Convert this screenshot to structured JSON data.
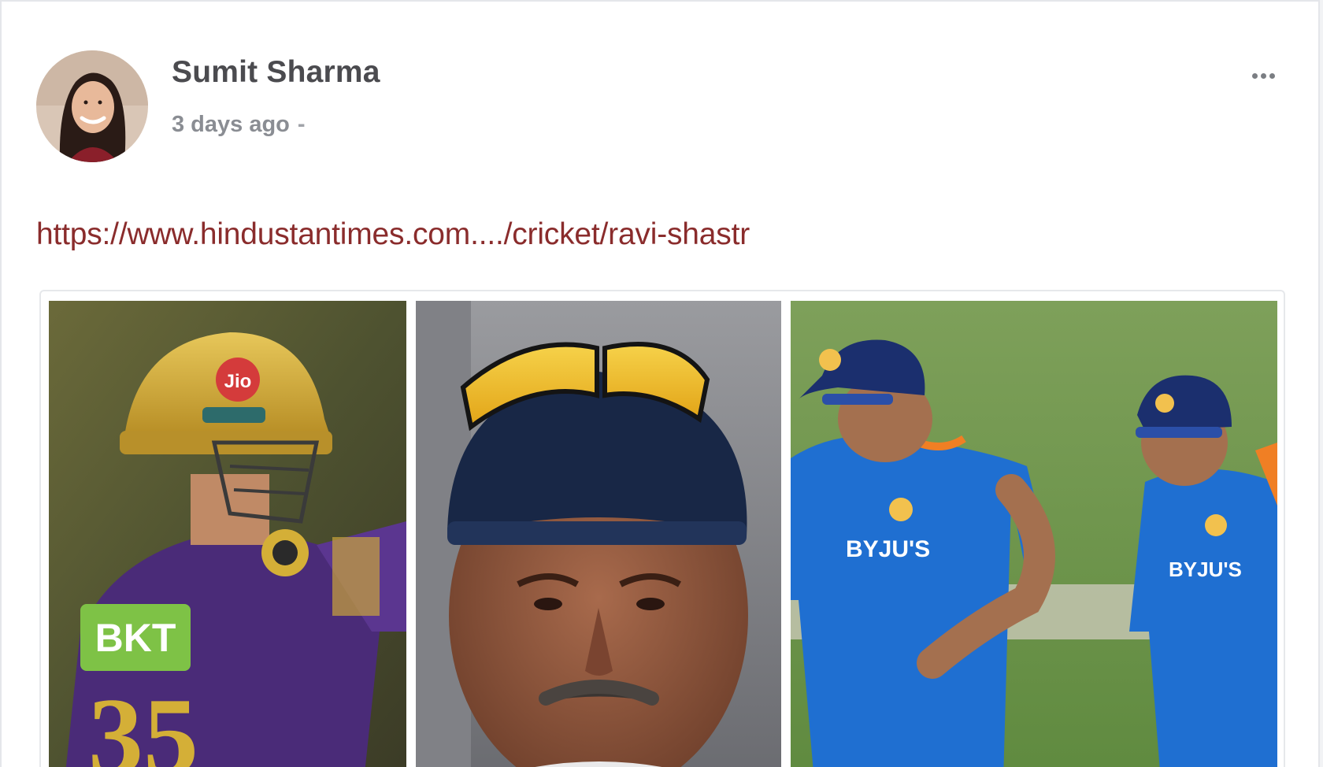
{
  "post": {
    "author": "Sumit Sharma",
    "timestamp": "3 days ago",
    "meta_separator": "-",
    "link_text": "https://www.hindustantimes.com..../cricket/ravi-shastr",
    "more_icon": "ellipsis-horizontal-icon"
  },
  "gallery": {
    "photos": [
      {
        "subject": "cricketer in purple kit with gold helmet",
        "helmet_text": "Jio",
        "jersey_sponsor": "BKT",
        "jersey_number": "35"
      },
      {
        "subject": "man in navy cap with yellow sunglasses, close-up"
      },
      {
        "subject": "two cricketers in blue training kit on field",
        "shirt_text": "BYJU'S"
      }
    ]
  },
  "colors": {
    "link": "#8a2c2c",
    "author": "#4b4b4f",
    "meta": "#8a8d93"
  }
}
